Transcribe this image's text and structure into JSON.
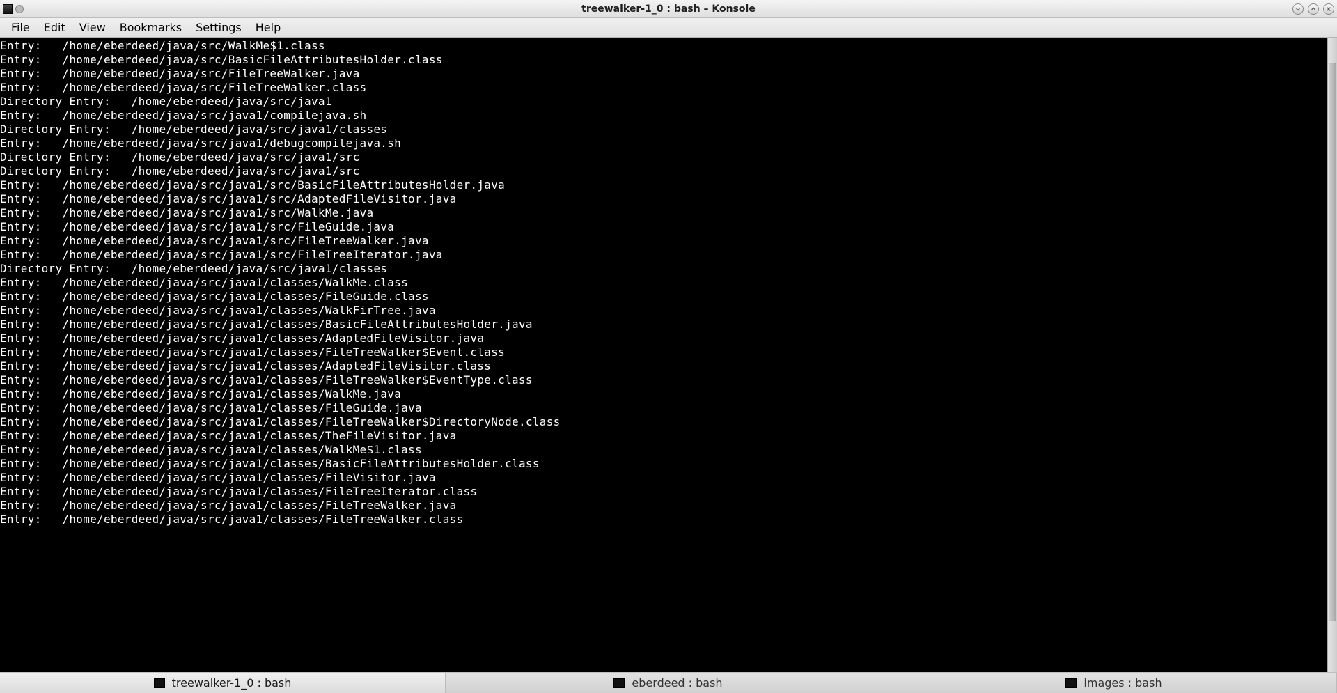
{
  "window_title": "treewalker-1_0 : bash – Konsole",
  "menu": {
    "file": "File",
    "edit": "Edit",
    "view": "View",
    "bookmarks": "Bookmarks",
    "settings": "Settings",
    "help": "Help"
  },
  "tabs": [
    {
      "label": "treewalker-1_0 : bash",
      "active": true
    },
    {
      "label": "eberdeed : bash",
      "active": false
    },
    {
      "label": "images : bash",
      "active": false
    }
  ],
  "scrollbar": {
    "thumb_top_pct": 4,
    "thumb_height_pct": 88
  },
  "terminal_lines": [
    "Entry:   /home/eberdeed/java/src/WalkMe$1.class",
    "Entry:   /home/eberdeed/java/src/BasicFileAttributesHolder.class",
    "Entry:   /home/eberdeed/java/src/FileTreeWalker.java",
    "Entry:   /home/eberdeed/java/src/FileTreeWalker.class",
    "Directory Entry:   /home/eberdeed/java/src/java1",
    "Entry:   /home/eberdeed/java/src/java1/compilejava.sh",
    "Directory Entry:   /home/eberdeed/java/src/java1/classes",
    "Entry:   /home/eberdeed/java/src/java1/debugcompilejava.sh",
    "Directory Entry:   /home/eberdeed/java/src/java1/src",
    "Directory Entry:   /home/eberdeed/java/src/java1/src",
    "Entry:   /home/eberdeed/java/src/java1/src/BasicFileAttributesHolder.java",
    "Entry:   /home/eberdeed/java/src/java1/src/AdaptedFileVisitor.java",
    "Entry:   /home/eberdeed/java/src/java1/src/WalkMe.java",
    "Entry:   /home/eberdeed/java/src/java1/src/FileGuide.java",
    "Entry:   /home/eberdeed/java/src/java1/src/FileTreeWalker.java",
    "Entry:   /home/eberdeed/java/src/java1/src/FileTreeIterator.java",
    "Directory Entry:   /home/eberdeed/java/src/java1/classes",
    "Entry:   /home/eberdeed/java/src/java1/classes/WalkMe.class",
    "Entry:   /home/eberdeed/java/src/java1/classes/FileGuide.class",
    "Entry:   /home/eberdeed/java/src/java1/classes/WalkFirTree.java",
    "Entry:   /home/eberdeed/java/src/java1/classes/BasicFileAttributesHolder.java",
    "Entry:   /home/eberdeed/java/src/java1/classes/AdaptedFileVisitor.java",
    "Entry:   /home/eberdeed/java/src/java1/classes/FileTreeWalker$Event.class",
    "Entry:   /home/eberdeed/java/src/java1/classes/AdaptedFileVisitor.class",
    "Entry:   /home/eberdeed/java/src/java1/classes/FileTreeWalker$EventType.class",
    "Entry:   /home/eberdeed/java/src/java1/classes/WalkMe.java",
    "Entry:   /home/eberdeed/java/src/java1/classes/FileGuide.java",
    "Entry:   /home/eberdeed/java/src/java1/classes/FileTreeWalker$DirectoryNode.class",
    "Entry:   /home/eberdeed/java/src/java1/classes/TheFileVisitor.java",
    "Entry:   /home/eberdeed/java/src/java1/classes/WalkMe$1.class",
    "Entry:   /home/eberdeed/java/src/java1/classes/BasicFileAttributesHolder.class",
    "Entry:   /home/eberdeed/java/src/java1/classes/FileVisitor.java",
    "Entry:   /home/eberdeed/java/src/java1/classes/FileTreeIterator.class",
    "Entry:   /home/eberdeed/java/src/java1/classes/FileTreeWalker.java",
    "Entry:   /home/eberdeed/java/src/java1/classes/FileTreeWalker.class"
  ]
}
